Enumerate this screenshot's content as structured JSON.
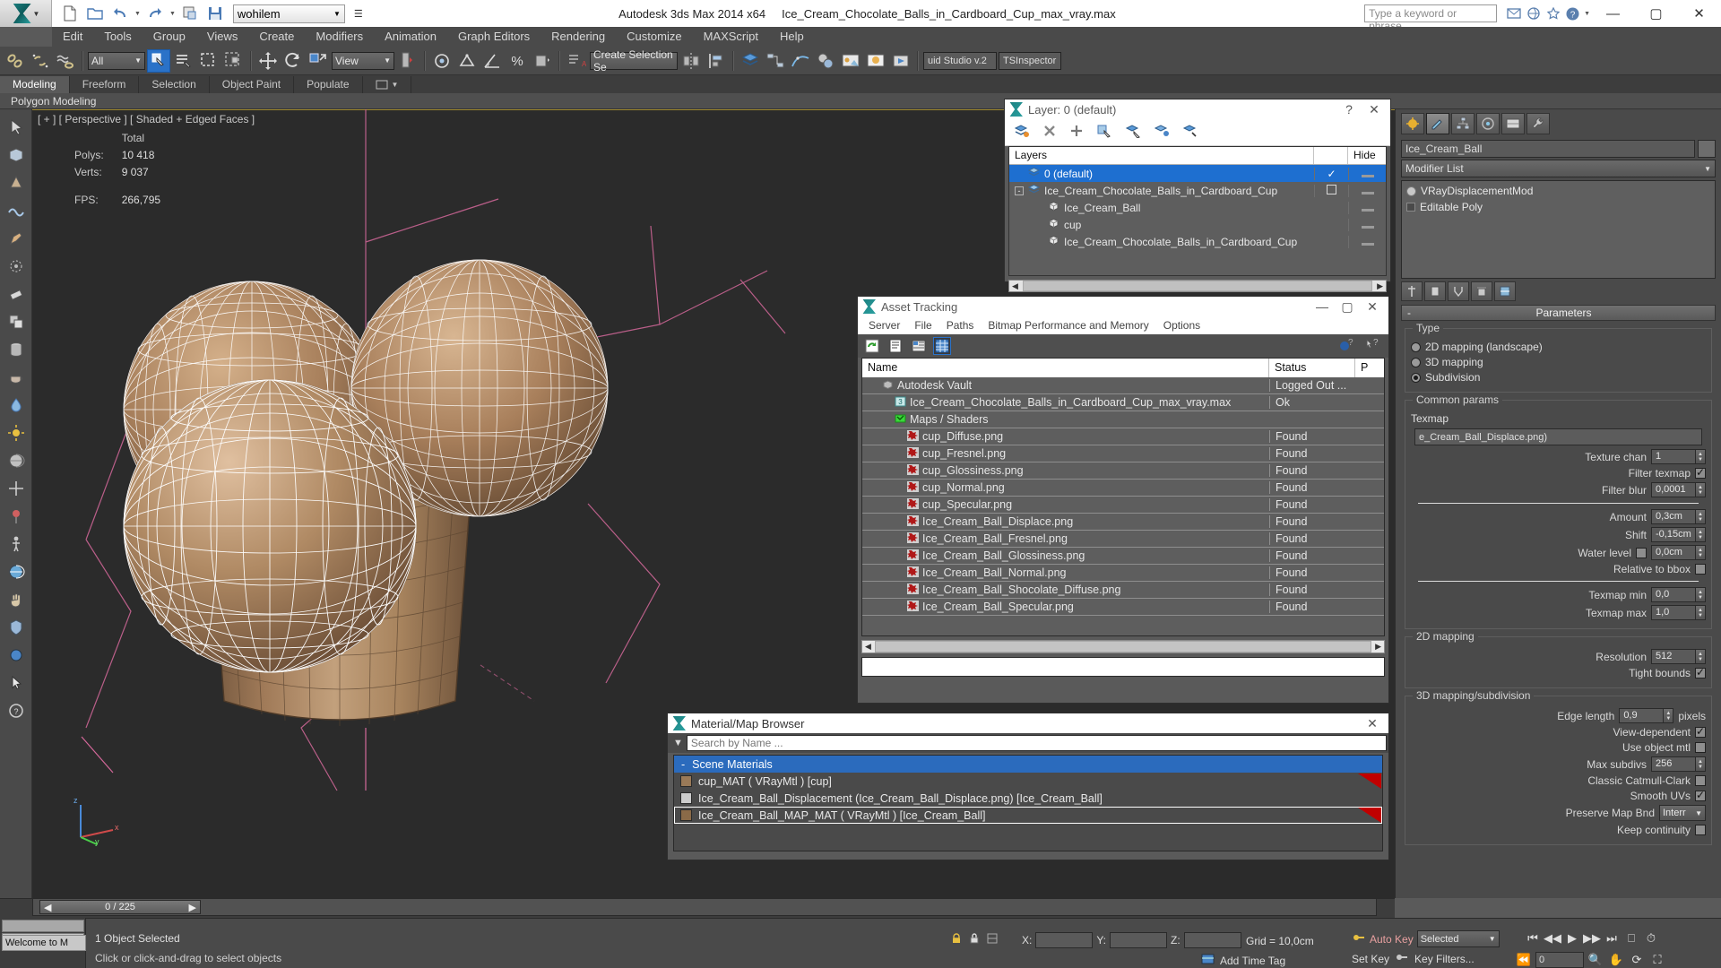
{
  "app": {
    "title": "Autodesk 3ds Max  2014 x64",
    "file_name": "Ice_Cream_Chocolate_Balls_in_Cardboard_Cup_max_vray.max",
    "workspace": "wohilem",
    "search_placeholder": "Type a keyword or phrase"
  },
  "menu": {
    "items": [
      "Edit",
      "Tools",
      "Group",
      "Views",
      "Create",
      "Modifiers",
      "Animation",
      "Graph Editors",
      "Rendering",
      "Customize",
      "MAXScript",
      "Help"
    ]
  },
  "toolbar": {
    "selection_filter": "All",
    "reference_coord": "View",
    "named_selection_set": "Create Selection Se",
    "render_setup_preset": "uid Studio v.2",
    "ts_inspector": "TSInspector"
  },
  "ribbon": {
    "tabs": [
      "Modeling",
      "Freeform",
      "Selection",
      "Object Paint",
      "Populate"
    ],
    "active_tab": "Modeling",
    "subtitle": "Polygon Modeling"
  },
  "viewport": {
    "label": "[ + ] [ Perspective ] [ Shaded + Edged Faces ]",
    "stats": {
      "total_header": "Total",
      "polys_label": "Polys:",
      "polys_value": "10 418",
      "verts_label": "Verts:",
      "verts_value": "9 037",
      "fps_label": "FPS:",
      "fps_value": "266,795"
    },
    "axis": {
      "x": "x",
      "y": "y",
      "z": "z"
    }
  },
  "layer_window": {
    "title": "Layer: 0 (default)",
    "columns": [
      "Layers",
      "",
      "Hide"
    ],
    "rows": [
      {
        "name": "0 (default)",
        "icon": "layer-icon",
        "indent": 0,
        "selected": true,
        "check": "check",
        "hide": "dash",
        "expander": ""
      },
      {
        "name": "Ice_Cream_Chocolate_Balls_in_Cardboard_Cup",
        "icon": "layer-icon",
        "indent": 0,
        "selected": false,
        "check": "box",
        "hide": "dash",
        "expander": "-"
      },
      {
        "name": "Ice_Cream_Ball",
        "icon": "object-icon",
        "indent": 1,
        "selected": false,
        "check": "",
        "hide": "dash",
        "expander": ""
      },
      {
        "name": "cup",
        "icon": "object-icon",
        "indent": 1,
        "selected": false,
        "check": "",
        "hide": "dash",
        "expander": ""
      },
      {
        "name": "Ice_Cream_Chocolate_Balls_in_Cardboard_Cup",
        "icon": "object-icon",
        "indent": 1,
        "selected": false,
        "check": "",
        "hide": "dash",
        "expander": ""
      }
    ],
    "help_btn": "?",
    "close_btn": "✕"
  },
  "asset_tracking": {
    "title": "Asset Tracking",
    "menu": [
      "Server",
      "File",
      "Paths",
      "Bitmap Performance and Memory",
      "Options"
    ],
    "columns": [
      "Name",
      "Status",
      "P"
    ],
    "rows": [
      {
        "name": "Autodesk Vault",
        "status": "Logged Out ...",
        "indent": 1,
        "icon": "vault-icon"
      },
      {
        "name": "Ice_Cream_Chocolate_Balls_in_Cardboard_Cup_max_vray.max",
        "status": "Ok",
        "indent": 2,
        "icon": "max-file-icon"
      },
      {
        "name": "Maps / Shaders",
        "status": "",
        "indent": 2,
        "icon": "maps-icon"
      },
      {
        "name": "cup_Diffuse.png",
        "status": "Found",
        "indent": 3,
        "icon": "bitmap-icon"
      },
      {
        "name": "cup_Fresnel.png",
        "status": "Found",
        "indent": 3,
        "icon": "bitmap-icon"
      },
      {
        "name": "cup_Glossiness.png",
        "status": "Found",
        "indent": 3,
        "icon": "bitmap-icon"
      },
      {
        "name": "cup_Normal.png",
        "status": "Found",
        "indent": 3,
        "icon": "bitmap-icon"
      },
      {
        "name": "cup_Specular.png",
        "status": "Found",
        "indent": 3,
        "icon": "bitmap-icon"
      },
      {
        "name": "Ice_Cream_Ball_Displace.png",
        "status": "Found",
        "indent": 3,
        "icon": "bitmap-icon"
      },
      {
        "name": "Ice_Cream_Ball_Fresnel.png",
        "status": "Found",
        "indent": 3,
        "icon": "bitmap-icon"
      },
      {
        "name": "Ice_Cream_Ball_Glossiness.png",
        "status": "Found",
        "indent": 3,
        "icon": "bitmap-icon"
      },
      {
        "name": "Ice_Cream_Ball_Normal.png",
        "status": "Found",
        "indent": 3,
        "icon": "bitmap-icon"
      },
      {
        "name": "Ice_Cream_Ball_Shocolate_Diffuse.png",
        "status": "Found",
        "indent": 3,
        "icon": "bitmap-icon"
      },
      {
        "name": "Ice_Cream_Ball_Specular.png",
        "status": "Found",
        "indent": 3,
        "icon": "bitmap-icon"
      }
    ],
    "minimize_btn": "—",
    "maximize_btn": "▢",
    "close_btn": "✕"
  },
  "material_browser": {
    "title": "Material/Map Browser",
    "close_btn": "✕",
    "search_placeholder": "Search by Name ...",
    "group_label": "Scene Materials",
    "group_toggle": "-",
    "items": [
      {
        "label": "cup_MAT  ( VRayMtl )  [cup]",
        "selected": false,
        "has_corner": true,
        "swatch": "#9a7a58"
      },
      {
        "label": "Ice_Cream_Ball_Displacement (Ice_Cream_Ball_Displace.png) [Ice_Cream_Ball]",
        "selected": false,
        "has_corner": false,
        "swatch": "#cccccc"
      },
      {
        "label": "Ice_Cream_Ball_MAP_MAT  ( VRayMtl )  [Ice_Cream_Ball]",
        "selected": true,
        "has_corner": true,
        "swatch": "#8a6a48"
      }
    ]
  },
  "command_panel": {
    "object_name": "Ice_Cream_Ball",
    "modifier_list_label": "Modifier List",
    "stack": [
      {
        "label": "VRayDisplacementMod",
        "type": "modifier"
      },
      {
        "label": "Editable Poly",
        "type": "base"
      }
    ],
    "rollout_title": "Parameters",
    "rollout_toggle": "-",
    "type_group": {
      "title": "Type",
      "options": [
        "2D mapping (landscape)",
        "3D mapping",
        "Subdivision"
      ],
      "selected": "Subdivision"
    },
    "common_params": {
      "title": "Common params",
      "texmap_label": "Texmap",
      "texmap_value": "e_Cream_Ball_Displace.png)",
      "texture_chan_label": "Texture chan",
      "texture_chan_value": "1",
      "filter_texmap_label": "Filter texmap",
      "filter_texmap_checked": true,
      "filter_blur_label": "Filter blur",
      "filter_blur_value": "0,0001",
      "amount_label": "Amount",
      "amount_value": "0,3cm",
      "shift_label": "Shift",
      "shift_value": "-0,15cm",
      "water_level_label": "Water level",
      "water_level_checked": false,
      "water_level_value": "0,0cm",
      "relative_bbox_label": "Relative to bbox",
      "relative_bbox_checked": false,
      "texmap_min_label": "Texmap min",
      "texmap_min_value": "0,0",
      "texmap_max_label": "Texmap max",
      "texmap_max_value": "1,0"
    },
    "mapping_2d": {
      "title": "2D mapping",
      "resolution_label": "Resolution",
      "resolution_value": "512",
      "tight_bounds_label": "Tight bounds",
      "tight_bounds_checked": true
    },
    "mapping_3d": {
      "title": "3D mapping/subdivision",
      "edge_length_label": "Edge length",
      "edge_length_value": "0,9",
      "edge_length_unit": "pixels",
      "view_dependent_label": "View-dependent",
      "view_dependent_checked": true,
      "use_object_mtl_label": "Use object mtl",
      "use_object_mtl_checked": false,
      "max_subdivs_label": "Max subdivs",
      "max_subdivs_value": "256",
      "classic_catmull_label": "Classic Catmull-Clark",
      "classic_catmull_checked": false,
      "smooth_uvs_label": "Smooth UVs",
      "smooth_uvs_checked": true,
      "preserve_map_label": "Preserve Map Bnd",
      "preserve_map_value": "Interr",
      "keep_continuity_label": "Keep continuity",
      "keep_continuity_checked": false
    }
  },
  "timeline": {
    "current_frame": "0 / 225"
  },
  "status_bar": {
    "welcome_text": "Welcome to M",
    "selection_info": "1 Object Selected",
    "prompt": "Click or click-and-drag to select objects",
    "x_label": "X:",
    "x_value": "",
    "y_label": "Y:",
    "y_value": "",
    "z_label": "Z:",
    "z_value": "",
    "grid_label": "Grid = 10,0cm",
    "add_time_tag": "Add Time Tag",
    "auto_key": "Auto Key",
    "set_key": "Set Key",
    "key_filters": "Key Filters...",
    "selected_mode": "Selected",
    "key_field": "0"
  }
}
